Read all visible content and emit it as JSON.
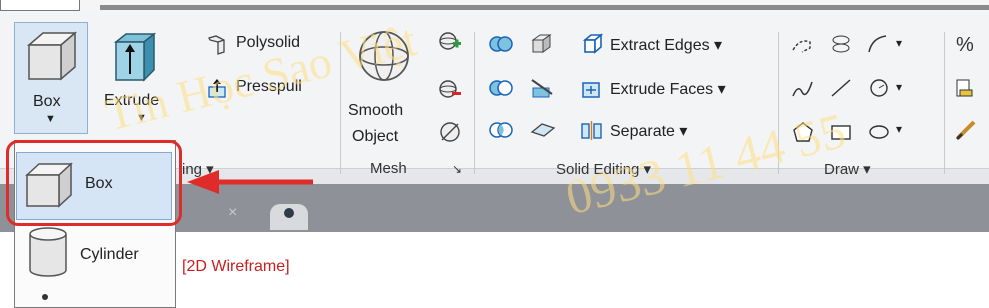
{
  "ribbon": {
    "box_button_label": "Box",
    "extrude_label": "Extrude",
    "polysolid_label": "Polysolid",
    "presspull_label": "Presspull",
    "smooth_label_line1": "Smooth",
    "smooth_label_line2": "Object",
    "modeling_panel_partial": "ing ▾",
    "mesh_panel": "Mesh",
    "mesh_launcher": "↘",
    "solid_editing": {
      "extract_edges": "Extract Edges ▾",
      "extrude_faces": "Extrude Faces ▾",
      "separate": "Separate ▾",
      "panel_title": "Solid Editing ▾"
    },
    "draw_panel": "Draw ▾"
  },
  "tabs": {
    "close_glyph": "×"
  },
  "viewport": {
    "view_label": "[2D Wireframe]"
  },
  "dropdown": {
    "items": [
      {
        "label": "Box",
        "icon": "box-icon",
        "selected": true
      },
      {
        "label": "Cylinder",
        "icon": "cylinder-icon",
        "selected": false
      }
    ]
  },
  "watermark": {
    "line1": "Tin Học Sao Việt",
    "line2": "0933 11 44 55"
  },
  "colors": {
    "highlight": "#e02b2b",
    "selected_fill": "#d5e5f6",
    "accent_blue": "#1a64b8",
    "viewport_label": "#c8201f"
  }
}
